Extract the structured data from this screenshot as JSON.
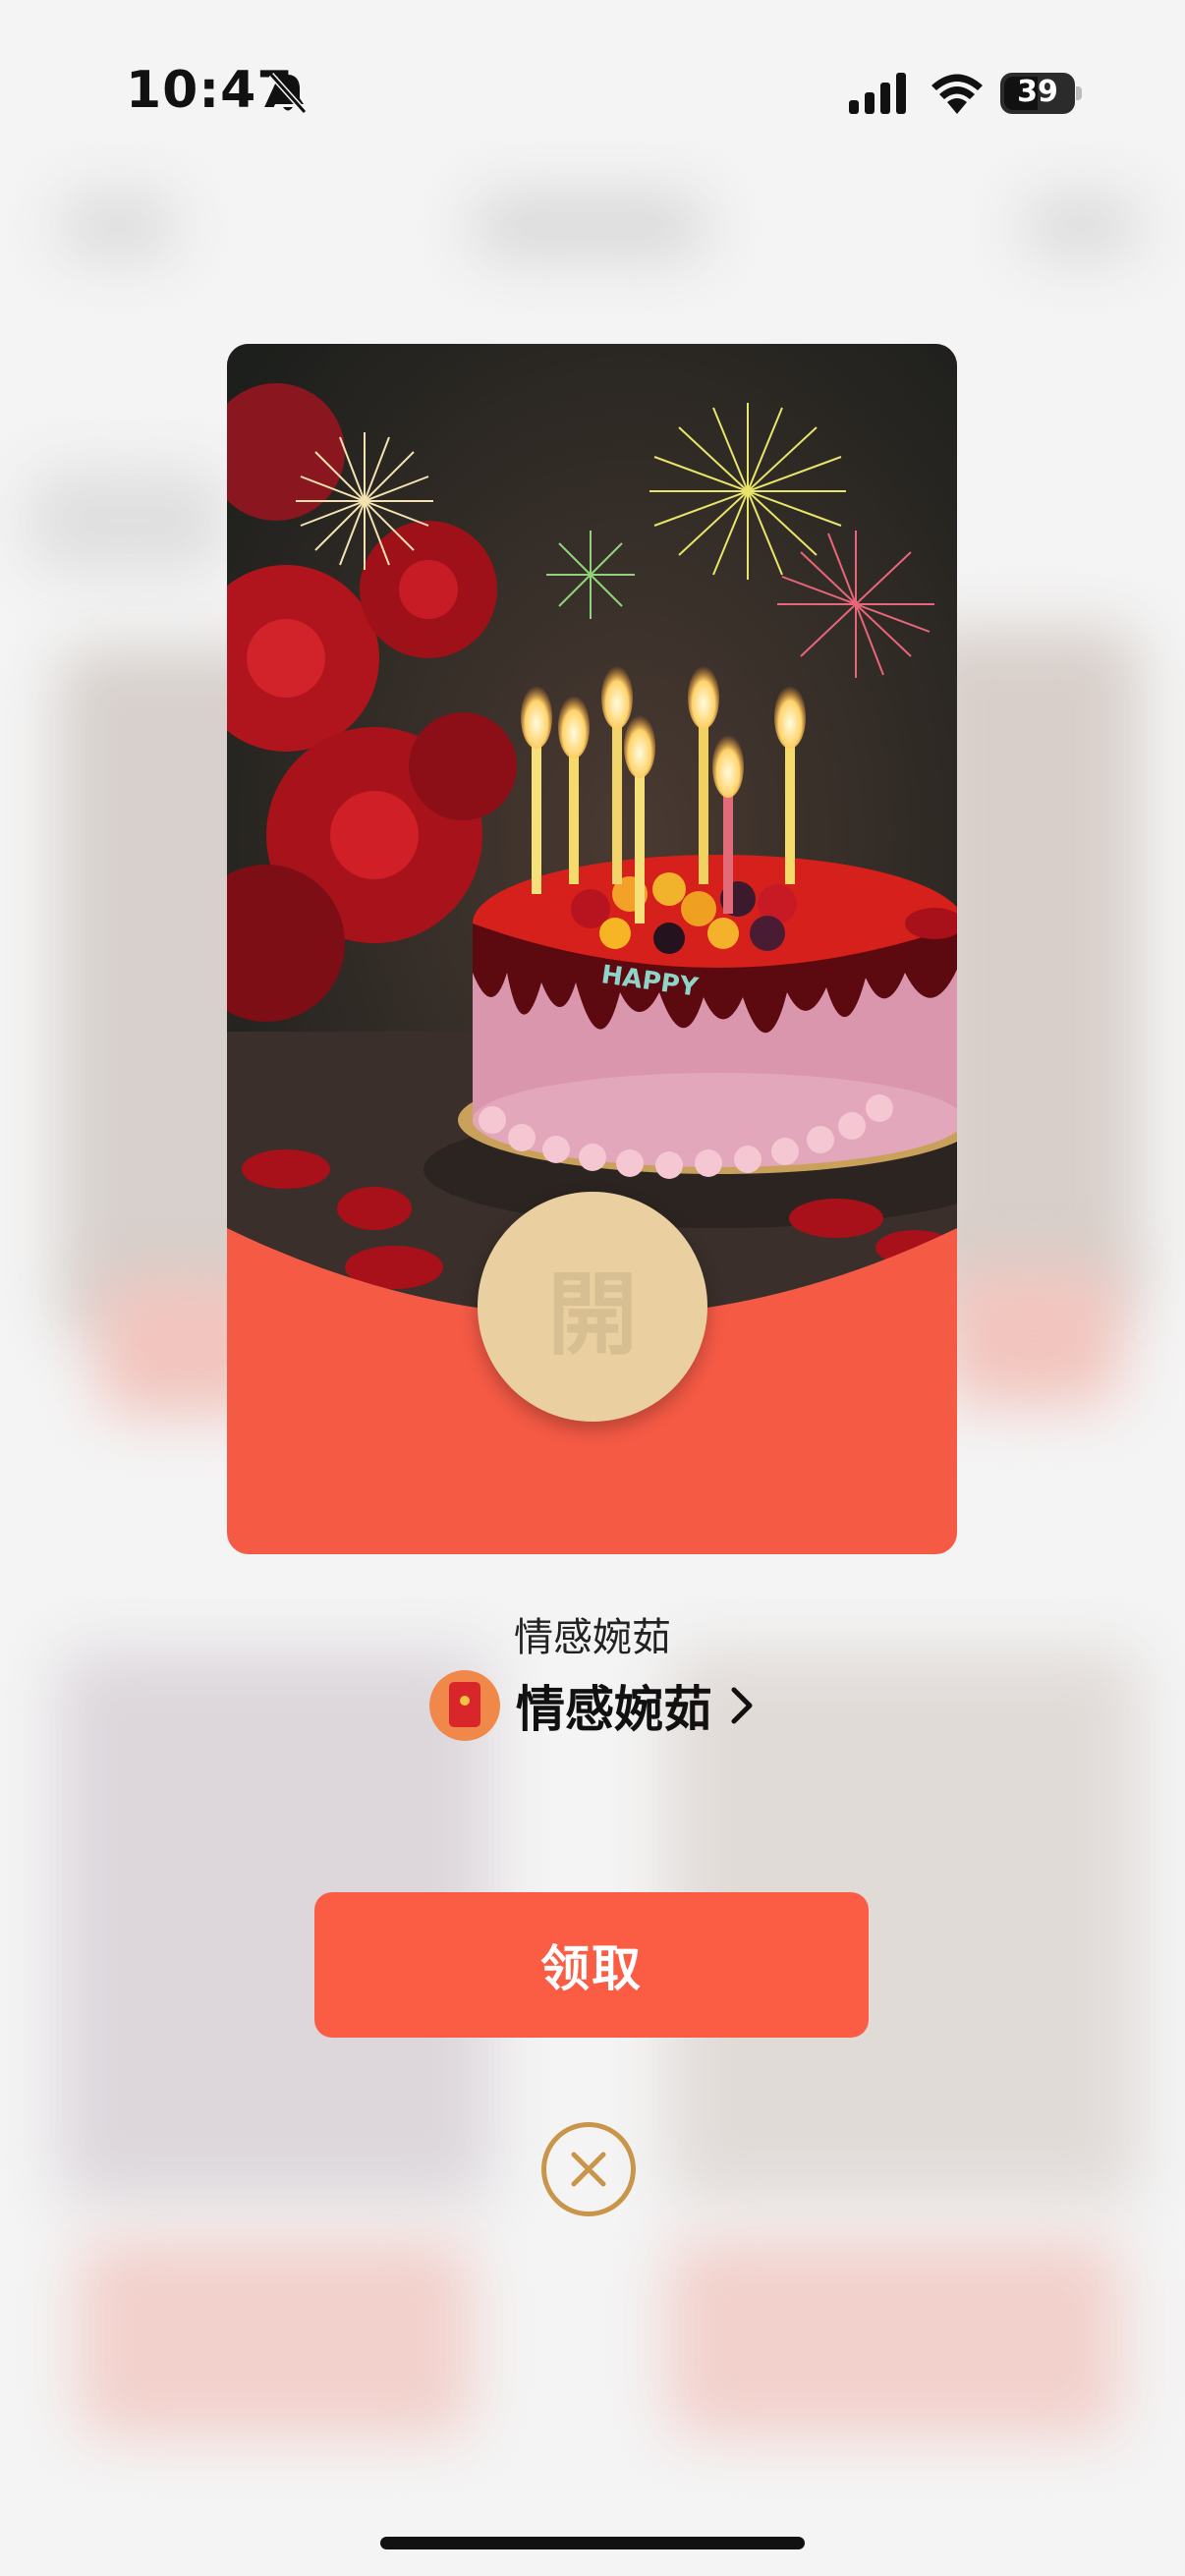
{
  "status_bar": {
    "time": "10:47",
    "battery_level": "39",
    "icons": [
      "bell-slash-icon",
      "cellular-signal-icon",
      "wifi-icon",
      "battery-icon"
    ]
  },
  "red_packet": {
    "open_label": "開",
    "cover_image": "birthday-cake-with-candles-roses-fireworks",
    "cake_text": "HAPPY"
  },
  "sender": {
    "label": "情感婉茹",
    "name": "情感婉茹",
    "avatar_icon": "red-envelope-icon",
    "chevron_icon": "chevron-right-icon"
  },
  "actions": {
    "receive_label": "领取",
    "close_icon": "close-circle-icon"
  },
  "colors": {
    "card_red": "#f55a45",
    "button_red": "#fa5d44",
    "open_gold": "#ead0a0",
    "close_gold": "#c9954b"
  }
}
